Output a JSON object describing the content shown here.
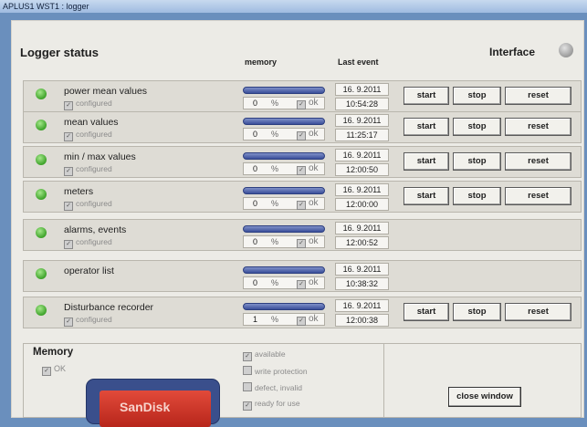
{
  "window": {
    "title": "APLUS1 WST1 : logger"
  },
  "header": {
    "title": "Logger status",
    "memory_label": "memory",
    "last_event_label": "Last event",
    "interface_label": "Interface"
  },
  "rows": [
    {
      "name": "power mean values",
      "configured": "configured",
      "memory_value": "0",
      "memory_unit": "%",
      "ok": "ok",
      "date": "16. 9.2011",
      "time": "10:54:28",
      "has_buttons": true
    },
    {
      "name": "mean values",
      "configured": "configured",
      "memory_value": "0",
      "memory_unit": "%",
      "ok": "ok",
      "date": "16. 9.2011",
      "time": "11:25:17",
      "has_buttons": true
    },
    {
      "name": "min / max values",
      "configured": "configured",
      "memory_value": "0",
      "memory_unit": "%",
      "ok": "ok",
      "date": "16. 9.2011",
      "time": "12:00:50",
      "has_buttons": true
    },
    {
      "name": "meters",
      "configured": "configured",
      "memory_value": "0",
      "memory_unit": "%",
      "ok": "ok",
      "date": "16. 9.2011",
      "time": "12:00:00",
      "has_buttons": true
    },
    {
      "name": "alarms, events",
      "configured": "configured",
      "memory_value": "0",
      "memory_unit": "%",
      "ok": "ok",
      "date": "16. 9.2011",
      "time": "12:00:52",
      "has_buttons": false
    },
    {
      "name": "operator list",
      "configured": "",
      "memory_value": "0",
      "memory_unit": "%",
      "ok": "ok",
      "date": "16. 9.2011",
      "time": "10:38:32",
      "has_buttons": false
    },
    {
      "name": "Disturbance recorder",
      "configured": "configured",
      "memory_value": "1",
      "memory_unit": "%",
      "ok": "ok",
      "date": "16. 9.2011",
      "time": "12:00:38",
      "has_buttons": true
    }
  ],
  "buttons": {
    "start": "start",
    "stop": "stop",
    "reset": "reset"
  },
  "memory": {
    "title": "Memory",
    "ok_label": "OK",
    "options": [
      "available",
      "write protection",
      "defect, invalid",
      "ready for use"
    ]
  },
  "close_button": "close window",
  "sdcard": {
    "logo": "SanDisk"
  },
  "colors": {
    "led_green": "#3ea22a",
    "memory_bar": "#3a4f9a",
    "background": "#6a8fbd"
  }
}
